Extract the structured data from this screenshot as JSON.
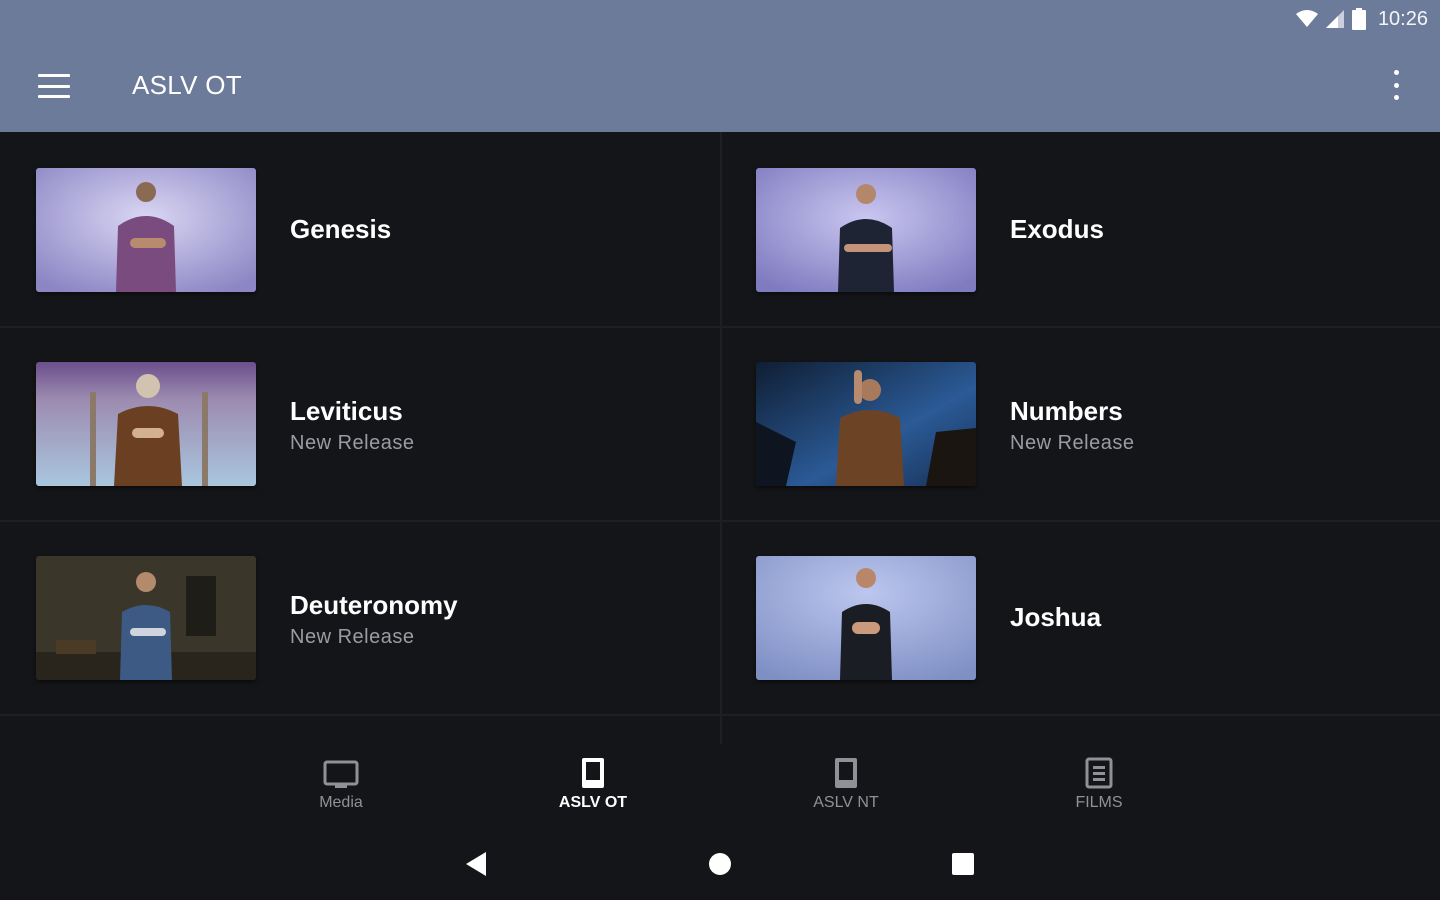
{
  "status_bar": {
    "time": "10:26"
  },
  "app_bar": {
    "title": "ASLV OT"
  },
  "books": [
    {
      "name": "Genesis",
      "subtitle": ""
    },
    {
      "name": "Exodus",
      "subtitle": ""
    },
    {
      "name": "Leviticus",
      "subtitle": "New Release"
    },
    {
      "name": "Numbers",
      "subtitle": "New Release"
    },
    {
      "name": "Deuteronomy",
      "subtitle": "New Release"
    },
    {
      "name": "Joshua",
      "subtitle": ""
    }
  ],
  "bottom_nav": [
    {
      "label": "Media",
      "icon": "tv-icon",
      "active": false
    },
    {
      "label": "ASLV OT",
      "icon": "book-icon",
      "active": true
    },
    {
      "label": "ASLV NT",
      "icon": "book-icon",
      "active": false
    },
    {
      "label": "FILMS",
      "icon": "film-icon",
      "active": false
    }
  ],
  "colors": {
    "app_bar": "#6d7b9a",
    "background": "#141518",
    "subtitle": "#9a9ca2",
    "nav_inactive": "#8f9196"
  }
}
